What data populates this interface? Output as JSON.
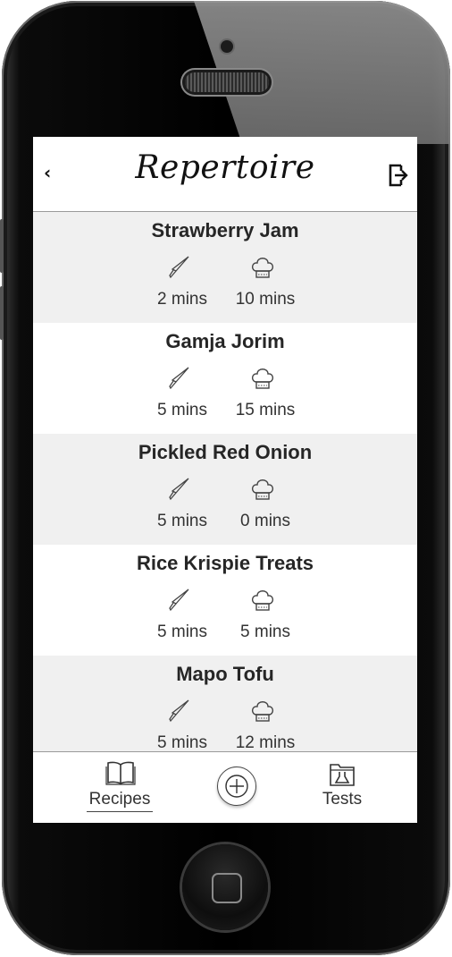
{
  "app": {
    "title": "Repertoire"
  },
  "header": {
    "back_label": "‹"
  },
  "recipes": [
    {
      "name": "Strawberry Jam",
      "prep": "2 mins",
      "cook": "10 mins"
    },
    {
      "name": "Gamja Jorim",
      "prep": "5 mins",
      "cook": "15 mins"
    },
    {
      "name": "Pickled Red Onion",
      "prep": "5 mins",
      "cook": "0 mins"
    },
    {
      "name": "Rice Krispie Treats",
      "prep": "5 mins",
      "cook": "5 mins"
    },
    {
      "name": "Mapo Tofu",
      "prep": "5 mins",
      "cook": "12 mins"
    }
  ],
  "bottom_nav": {
    "recipes_label": "Recipes",
    "tests_label": "Tests"
  },
  "icons": {
    "back": "chevron-left-icon",
    "logout": "logout-icon",
    "prep": "knife-icon",
    "cook": "chef-hat-icon",
    "recipes_tab": "book-icon",
    "add": "plus-circle-icon",
    "tests_tab": "flask-folder-icon"
  },
  "colors": {
    "row_shaded": "#f0f0f0",
    "text": "#262626"
  }
}
